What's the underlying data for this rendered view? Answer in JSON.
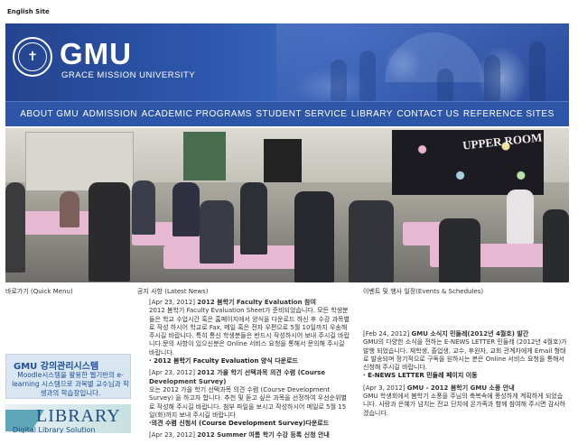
{
  "top_link": "English Site",
  "header": {
    "logo_text": "GMU",
    "logo_sub": "GRACE MISSION UNIVERSITY",
    "seal_icon": "university-seal-icon"
  },
  "nav": [
    "ABOUT GMU",
    "ADMISSION",
    "ACADEMIC PROGRAMS",
    "STUDENT SERVICE",
    "LIBRARY",
    "CONTACT US",
    "REFERENCE SITES"
  ],
  "hero": {
    "sign_text": "UPPER ROOM"
  },
  "quick_menu": {
    "title": "바로가기 (Quick Menu)",
    "promo1_title": "GMU 강의관리시스템",
    "promo1_sub": "Moodle시스템을 활용한 웹기반의 e-learning 시스템으로 과목별 교수님과 학생과의 학습장입니다.",
    "promo2_title": "LIBRARY",
    "promo2_sub": "Digital Library Solution"
  },
  "news": {
    "title": "공지 사항 (Latest News)",
    "items": [
      {
        "date": "[Apr 23, 2012]",
        "headline": "2012 봄학기 Faculty Evaluation 참여",
        "body": "2012 봄학기 Faculty Evaluation Sheet가 준비되었습니다. 모든 학생분들은 학교 수업시간 혹은 홈페이지에서 양식을 다운로드 하신 후 수강 과목별로 작성 하시어 학교로 Fax, 메일 혹은 전자 우편으로 5월 10일까지 우송해 주시길 바랍니다. 특히 통신 학생분들은 반드시 작성하시어 보내 주시길 바랍니다.문의 사항이 있으신분은 Online 서비스 요청을 통해서 문의해 주시길 바랍니다.",
        "link": "· 2012 봄학기 Faculty Evaluation 양식 다운로드"
      },
      {
        "date": "[Apr 23, 2012]",
        "headline": "2012 가을 학기 선택과목 의견 수렴 (Course Development Survey)",
        "body": "오는 2012 가을 학기 선택과목 의견 수렴 (Course Development Survey) 을 하고자 합니다. 추천 및 듣고 싶은 과목을 선정하여 우선순위별로 작성해 주시길 바랍니다. 첨부 파일을 보시고 작성하시어 메일로 5월 15일(화)까지 보내 주시길 바랍니다",
        "link": "·의견 수렴 신청서 (Course Development Survey)다운로드"
      },
      {
        "date": "[Apr 23, 2012]",
        "headline": "2012 Summer 여름 학기 수강 등록 신청 안내",
        "body": "",
        "link": ""
      }
    ]
  },
  "events": {
    "title": "이벤트 및 행사 일정(Events & Schedules)",
    "items": [
      {
        "date": "[Feb 24, 2012]",
        "headline": "GMU 소식지 민들레(2012년 4월호) 발간",
        "body": "GMU의 다양한 소식을 전하는 E-NEWS LETTER 민들레 (2012년 4월호)가 발행 되었습니다. 재학생, 졸업생, 교수, 후원자, 교회 관계자에게 Email 형태로 발송되며 정기적으로 구독을 원하시는 분은 Online 서비스 요청을 통해서 신청해 주시길 바랍니다.",
        "link": "· E-NEWS LETTER 민들레 페이지 이동"
      },
      {
        "date": "[Apr 3, 2012]",
        "headline": "GMU - 2012 봄학기 GMU 소풍 안내",
        "body": "GMU 학생회에서 봄학기 소풍을 주님의 축복속에 풍성하게 계획하게 되었습니다. 사랑과 은혜가 넘치는 전교 단치에 온가족과 함께 참여해 주시면 감사하겠습니다.",
        "link": ""
      }
    ]
  }
}
